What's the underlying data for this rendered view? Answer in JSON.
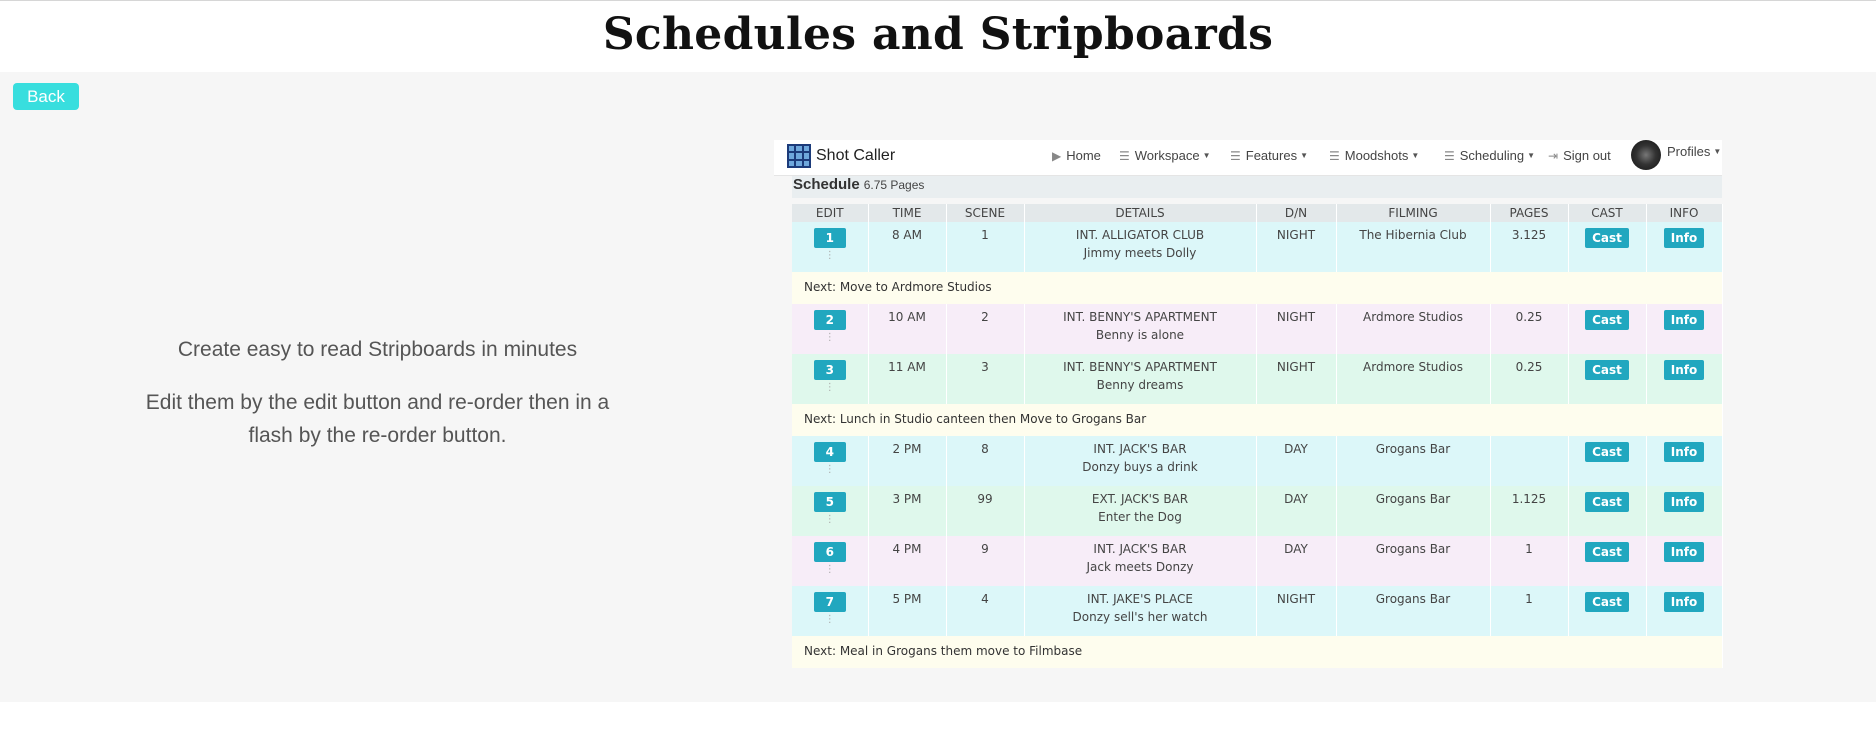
{
  "page": {
    "title": "Schedules and Stripboards",
    "back_label": "Back",
    "promo_line1": "Create easy to read Stripboards in minutes",
    "promo_line2": "Edit them by the edit button and re-order then in a flash by the re-order button."
  },
  "app": {
    "brand": "Shot Caller",
    "nav": [
      "Home",
      "Workspace",
      "Features",
      "Moodshots",
      "Scheduling",
      "Sign out",
      "Profiles"
    ],
    "schedule_title": "Schedule",
    "schedule_pages": "6.75 Pages",
    "columns": [
      "EDIT",
      "TIME",
      "SCENE",
      "DETAILS",
      "D/N",
      "FILMING",
      "PAGES",
      "CAST",
      "INFO"
    ],
    "cast_label": "Cast",
    "info_label": "Info",
    "rows": [
      {
        "num": "1",
        "time": "8 AM",
        "scene": "1",
        "set": "INT. ALLIGATOR CLUB",
        "desc": "Jimmy meets Dolly",
        "dn": "NIGHT",
        "filming": "The Hibernia Club",
        "pages": "3.125"
      },
      {
        "note": "Next: Move to Ardmore Studios"
      },
      {
        "num": "2",
        "time": "10 AM",
        "scene": "2",
        "set": "INT. BENNY'S APARTMENT",
        "desc": "Benny is alone",
        "dn": "NIGHT",
        "filming": "Ardmore Studios",
        "pages": "0.25"
      },
      {
        "num": "3",
        "time": "11 AM",
        "scene": "3",
        "set": "INT. BENNY'S APARTMENT",
        "desc": "Benny dreams",
        "dn": "NIGHT",
        "filming": "Ardmore Studios",
        "pages": "0.25"
      },
      {
        "note": "Next: Lunch in Studio canteen then Move to Grogans Bar"
      },
      {
        "num": "4",
        "time": "2 PM",
        "scene": "8",
        "set": "INT. JACK'S BAR",
        "desc": "Donzy buys a drink",
        "dn": "DAY",
        "filming": "Grogans Bar",
        "pages": ""
      },
      {
        "num": "5",
        "time": "3 PM",
        "scene": "99",
        "set": "EXT. JACK'S BAR",
        "desc": "Enter the Dog",
        "dn": "DAY",
        "filming": "Grogans Bar",
        "pages": "1.125"
      },
      {
        "num": "6",
        "time": "4 PM",
        "scene": "9",
        "set": "INT. JACK'S BAR",
        "desc": "Jack meets Donzy",
        "dn": "DAY",
        "filming": "Grogans Bar",
        "pages": "1"
      },
      {
        "num": "7",
        "time": "5 PM",
        "scene": "4",
        "set": "INT. JAKE'S PLACE",
        "desc": "Donzy sell's her watch",
        "dn": "NIGHT",
        "filming": "Grogans Bar",
        "pages": "1"
      },
      {
        "note": "Next: Meal in Grogans them move to Filmbase"
      }
    ]
  },
  "colors": {
    "back_button": "#38dede",
    "badge": "#21a7bf",
    "row_cyan": "#dcf7f9",
    "row_pink": "#f7edf8",
    "row_green": "#dff8ec",
    "row_note": "#fefdee"
  },
  "icons": [
    "logo-icon",
    "play-icon",
    "menu-icon",
    "signout-icon",
    "drag-handle-icon",
    "chevron-down-icon",
    "avatar"
  ]
}
